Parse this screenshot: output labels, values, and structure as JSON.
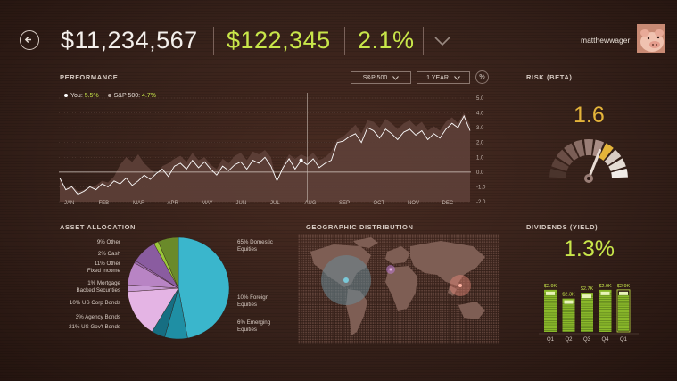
{
  "header": {
    "portfolio_value": "$11,234,567",
    "change_value": "$122,345",
    "change_percent": "2.1%",
    "username": "matthewwager"
  },
  "colors": {
    "accent_green": "#c8e64a",
    "you_line": "#ffffff",
    "sp_area": "#5e4038",
    "gold": "#e4b43a"
  },
  "performance": {
    "title": "PERFORMANCE",
    "benchmark_select": "S&P 500",
    "range_select": "1 YEAR",
    "percent_toggle": "%",
    "legend": {
      "you_label": "You:",
      "you_value": "5.5%",
      "sp_label": "S&P 500:",
      "sp_value": "4.7%"
    }
  },
  "risk": {
    "title": "RISK (BETA)",
    "value": "1.6",
    "level": 0.62
  },
  "asset_allocation": {
    "title": "ASSET ALLOCATION",
    "labels_left": [
      "9% Other",
      "2% Cash",
      "11% Other\nFixed Income",
      "1% Mortgage\nBacked Securities",
      "10% US Corp Bonds",
      "3% Agency Bonds",
      "21% US Gov't Bonds"
    ],
    "labels_right": [
      "65% Domestic\nEquities",
      "10% Foreign\nEquities",
      "6% Emerging\nEquities"
    ]
  },
  "geo": {
    "title": "GEOGRAPHIC DISTRIBUTION"
  },
  "dividends": {
    "title": "DIVIDENDS (YIELD)",
    "value": "1.3%"
  },
  "chart_data": [
    {
      "type": "line",
      "title": "PERFORMANCE",
      "x": [
        "JAN",
        "FEB",
        "MAR",
        "APR",
        "MAY",
        "JUN",
        "JUL",
        "AUG",
        "SEP",
        "OCT",
        "NOV",
        "DEC"
      ],
      "ylim": [
        -2.0,
        5.0
      ],
      "yticks": [
        "5.0",
        "4.0",
        "3.0",
        "2.0",
        "1.0",
        "0.0",
        "-1.0",
        "-2.0"
      ],
      "series": [
        {
          "name": "You",
          "values": [
            -0.4,
            -1.2,
            -1.0,
            -1.5,
            -1.3,
            -1.0,
            -1.2,
            -0.8,
            -1.0,
            -0.6,
            -0.8,
            -0.4,
            -0.9,
            -0.6,
            -0.2,
            -0.5,
            -0.1,
            0.2,
            -0.3,
            0.4,
            0.6,
            0.2,
            0.8,
            0.3,
            0.7,
            0.2,
            -0.2,
            0.4,
            0.1,
            0.5,
            0.7,
            0.2,
            0.8,
            0.6,
            1.0,
            0.4,
            -0.6,
            0.3,
            0.9,
            0.2,
            0.8,
            0.5,
            0.9,
            0.3,
            0.6,
            0.8,
            2.0,
            2.1,
            2.4,
            2.6,
            2.0,
            3.0,
            2.8,
            2.3,
            2.9,
            2.6,
            2.2,
            2.7,
            2.9,
            2.5,
            2.8,
            2.2,
            2.6,
            2.3,
            2.9,
            3.3,
            3.0,
            3.8,
            2.8
          ]
        },
        {
          "name": "S&P 500",
          "values": [
            -0.4,
            -1.1,
            -0.9,
            -1.3,
            -1.2,
            -1.0,
            -0.9,
            -0.6,
            -0.7,
            -0.3,
            0.5,
            1.0,
            0.7,
            1.2,
            0.6,
            0.2,
            -0.2,
            0.4,
            0.6,
            0.9,
            1.1,
            0.7,
            1.3,
            0.8,
            1.0,
            0.5,
            0.2,
            0.9,
            0.6,
            1.1,
            1.3,
            0.8,
            1.4,
            1.2,
            1.5,
            1.0,
            -0.8,
            0.5,
            1.2,
            0.9,
            1.2,
            1.0,
            1.3,
            0.8,
            1.0,
            1.4,
            2.2,
            2.4,
            2.8,
            3.2,
            2.6,
            3.5,
            3.4,
            3.0,
            3.6,
            3.3,
            2.9,
            3.3,
            3.5,
            3.1,
            3.4,
            2.8,
            3.1,
            2.8,
            3.4,
            3.7,
            3.3,
            4.0,
            3.2
          ]
        }
      ]
    },
    {
      "type": "pie",
      "title": "ASSET ALLOCATION",
      "categories": [
        "Domestic Equities",
        "Foreign Equities",
        "Emerging Equities",
        "US Gov't Bonds",
        "Agency Bonds",
        "US Corp Bonds",
        "Mortgage Backed Securities",
        "Other Fixed Income",
        "Cash",
        "Other"
      ],
      "values": [
        65,
        10,
        6,
        21,
        3,
        10,
        1,
        11,
        2,
        9
      ],
      "colors": [
        "#3ab6cc",
        "#1f8fa4",
        "#166e82",
        "#e4b4e4",
        "#c89ad4",
        "#b884c4",
        "#9a6aae",
        "#8a5ca0",
        "#9ac83a",
        "#6a8a2a"
      ]
    },
    {
      "type": "bar",
      "title": "DIVIDENDS (YIELD)",
      "categories": [
        "Q1",
        "Q2",
        "Q3",
        "Q4",
        "Q1"
      ],
      "values": [
        2.9,
        2.3,
        2.7,
        2.9,
        2.9
      ],
      "labels": [
        "$2.9K",
        "$2.3K",
        "$2.7K",
        "$2.9K",
        "$2.9K"
      ]
    }
  ]
}
